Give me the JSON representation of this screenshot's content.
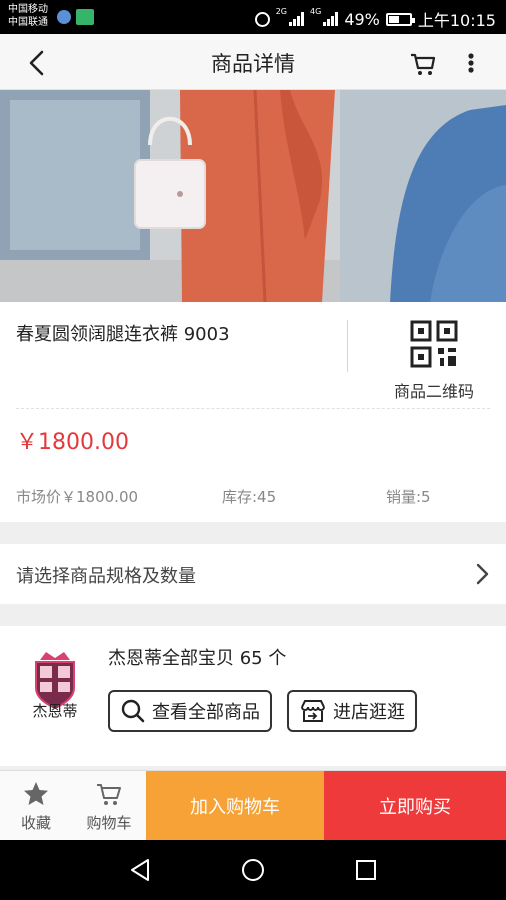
{
  "status_bar": {
    "carrier_1": "中国移动",
    "carrier_2": "中国联通",
    "net_1": "2G",
    "net_2": "4G",
    "battery": "49%",
    "time": "上午10:15"
  },
  "header": {
    "title": "商品详情",
    "icons": [
      "back-arrow-icon",
      "cart-icon",
      "more-vertical-icon"
    ]
  },
  "product": {
    "title": "春夏圆领阔腿连衣裤 9003",
    "qr_label": "商品二维码",
    "price": "￥1800.00",
    "market_price": "市场价￥1800.00",
    "stock": "库存:45",
    "sales": "销量:5"
  },
  "spec": {
    "label": "请选择商品规格及数量"
  },
  "store": {
    "logo_text": "杰恩蒂",
    "summary": "杰恩蒂全部宝贝 65 个",
    "view_all": "查看全部商品",
    "visit_store": "进店逛逛"
  },
  "bottom_bar": {
    "favorite": "收藏",
    "cart": "购物车",
    "add_to_cart": "加入购物车",
    "buy_now": "立即购买"
  },
  "colors": {
    "price": "#e4393c",
    "add_to_cart_bg": "#f7a237",
    "buy_now_bg": "#ee3a3a"
  }
}
